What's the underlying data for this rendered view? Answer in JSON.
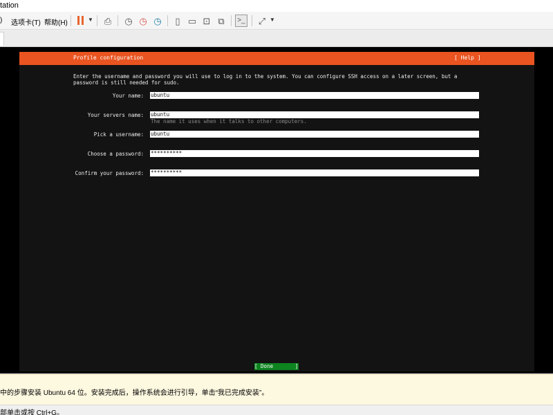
{
  "window": {
    "title": "tation"
  },
  "menubar": {
    "items": [
      {
        "label": ")"
      },
      {
        "label": "选项卡(T)"
      },
      {
        "label": "帮助(H)"
      }
    ]
  },
  "toolbar": {
    "icons": [
      "pause-icon",
      "dropdown-caret-icon",
      "send-keys-icon",
      "snapshot-icon",
      "revert-snapshot-icon",
      "snapshot-manager-icon",
      "show-library-icon",
      "thumbnail-bar-icon",
      "fit-window-icon",
      "unity-view-icon",
      "console-view-icon",
      "fullscreen-icon"
    ],
    "accent": "#e8642c"
  },
  "installer": {
    "header_title": "Profile configuration",
    "help_label": "[ Help ]",
    "header_color": "#e95420",
    "intro_line1": "Enter the username and password you will use to log in to the system. You can configure SSH access on a later screen, but a",
    "intro_line2": "password is still needed for sudo.",
    "fields": [
      {
        "label": "Your name:",
        "value": "ubuntu"
      },
      {
        "label": "Your servers name:",
        "value": "ubuntu",
        "hint": "The name it uses when it talks to other computers."
      },
      {
        "label": "Pick a username:",
        "value": "ubuntu"
      },
      {
        "label": "Choose a password:",
        "value": "**********"
      },
      {
        "label": "Confirm your password:",
        "value": "**********"
      }
    ],
    "done_label": "[ Done       ]",
    "done_color": "#0e8420"
  },
  "notice": {
    "text": "中的步骤安装 Ubuntu 64 位。安装完成后，操作系统会进行引导，单击“我已完成安装”。"
  },
  "statusbar": {
    "text": "部单击或按 Ctrl+G。"
  }
}
